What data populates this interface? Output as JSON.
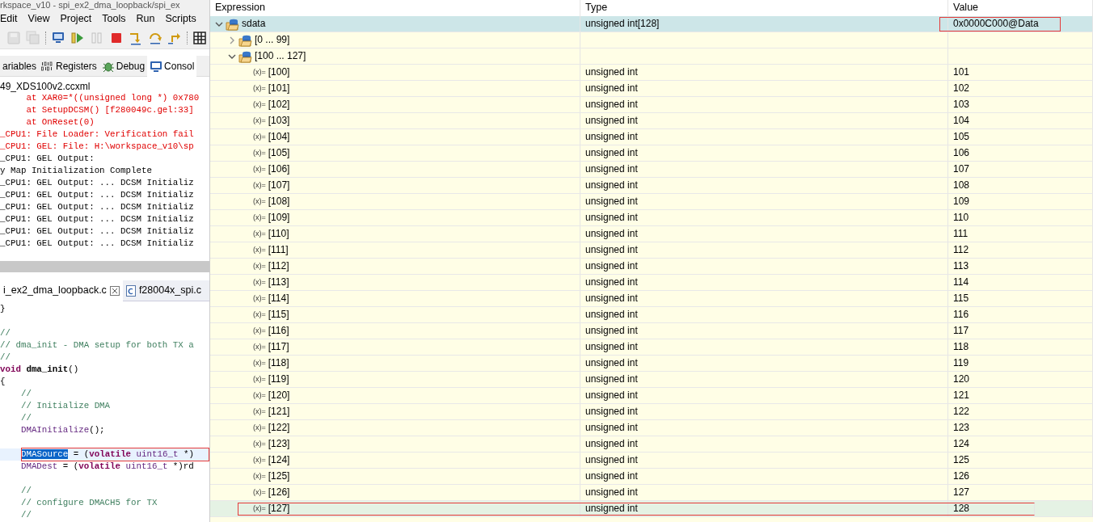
{
  "left_panel": {
    "title_fragment": "rkspace_v10 - spi_ex2_dma_loopback/spi_ex",
    "menu": [
      "Edit",
      "View",
      "Project",
      "Tools",
      "Run",
      "Scripts"
    ],
    "toolbar": [
      {
        "kind": "save",
        "disabled": true
      },
      {
        "kind": "save-all",
        "disabled": true
      },
      {
        "kind": "separator"
      },
      {
        "kind": "debug",
        "disabled": false
      },
      {
        "kind": "resume",
        "disabled": false
      },
      {
        "kind": "suspend",
        "disabled": true
      },
      {
        "kind": "terminate",
        "disabled": false
      },
      {
        "kind": "step-into",
        "disabled": false
      },
      {
        "kind": "step-over",
        "disabled": false
      },
      {
        "kind": "step-return",
        "disabled": false
      },
      {
        "kind": "separator"
      },
      {
        "kind": "grid",
        "disabled": false
      }
    ],
    "view_tabs": [
      {
        "label": "ariables",
        "kind": "none",
        "selected": false
      },
      {
        "label": "Registers",
        "kind": "registers",
        "selected": false
      },
      {
        "label": "Debug",
        "kind": "debug",
        "selected": false
      },
      {
        "label": "Consol",
        "kind": "console",
        "selected": true
      }
    ],
    "console": {
      "title": "49_XDS100v2.ccxml",
      "lines": [
        {
          "text": "     at XAR0=*((unsigned long *) 0x780",
          "kind": "error"
        },
        {
          "text": "     at SetupDCSM() [f280049c.gel:33]",
          "kind": "error"
        },
        {
          "text": "     at OnReset(0)",
          "kind": "error"
        },
        {
          "text": "_CPU1: File Loader: Verification fail",
          "kind": "error"
        },
        {
          "text": "_CPU1: GEL: File: H:\\workspace_v10\\sp",
          "kind": "error"
        },
        {
          "text": "_CPU1: GEL Output:",
          "kind": "normal"
        },
        {
          "text": "y Map Initialization Complete",
          "kind": "normal"
        },
        {
          "text": "_CPU1: GEL Output: ... DCSM Initializ",
          "kind": "normal"
        },
        {
          "text": "_CPU1: GEL Output: ... DCSM Initializ",
          "kind": "normal"
        },
        {
          "text": "_CPU1: GEL Output: ... DCSM Initializ",
          "kind": "normal"
        },
        {
          "text": "_CPU1: GEL Output: ... DCSM Initializ",
          "kind": "normal"
        },
        {
          "text": "_CPU1: GEL Output: ... DCSM Initializ",
          "kind": "normal"
        },
        {
          "text": "_CPU1: GEL Output: ... DCSM Initializ",
          "kind": "normal"
        }
      ]
    },
    "editor": {
      "tabs": [
        {
          "label": "i_ex2_dma_loopback.c",
          "kind": "active",
          "selected": true
        },
        {
          "label": "f28004x_spi.c",
          "kind": "c-file",
          "selected": false
        }
      ],
      "lines": [
        {
          "current": false,
          "marked": false,
          "segments": [
            {
              "text": "}",
              "kind": "plain"
            }
          ]
        },
        {
          "current": false,
          "marked": false
        },
        {
          "current": false,
          "marked": false,
          "segments": [
            {
              "text": "//",
              "kind": "comment"
            }
          ]
        },
        {
          "current": false,
          "marked": false,
          "segments": [
            {
              "text": "// dma_init - DMA setup for both TX a",
              "kind": "comment"
            }
          ]
        },
        {
          "current": false,
          "marked": false,
          "segments": [
            {
              "text": "//",
              "kind": "comment"
            }
          ]
        },
        {
          "current": false,
          "marked": false,
          "segments": [
            {
              "text": "void",
              "kind": "keyword"
            },
            {
              "text": " dma_init",
              "kind": "function"
            },
            {
              "text": "()",
              "kind": "plain"
            }
          ]
        },
        {
          "current": false,
          "marked": false,
          "segments": [
            {
              "text": "{",
              "kind": "plain"
            }
          ]
        },
        {
          "current": false,
          "marked": false,
          "segments": [
            {
              "text": "    //",
              "kind": "comment"
            }
          ]
        },
        {
          "current": false,
          "marked": false,
          "segments": [
            {
              "text": "    // Initialize DMA",
              "kind": "comment"
            }
          ]
        },
        {
          "current": false,
          "marked": false,
          "segments": [
            {
              "text": "    //",
              "kind": "comment"
            }
          ]
        },
        {
          "current": false,
          "marked": false,
          "segments": [
            {
              "text": "    DMAInitialize",
              "kind": "macro"
            },
            {
              "text": "();",
              "kind": "plain"
            }
          ]
        },
        {
          "current": false,
          "marked": false
        },
        {
          "current": true,
          "marked": true,
          "segments": [
            {
              "text": "DMASource",
              "kind": "selection"
            },
            {
              "text": " = (",
              "kind": "plain"
            },
            {
              "text": "volatile",
              "kind": "keyword"
            },
            {
              "text": " uint16_t",
              "kind": "macro"
            },
            {
              "text": " *)",
              "kind": "plain"
            }
          ]
        },
        {
          "current": false,
          "marked": false,
          "segments": [
            {
              "text": "    DMADest",
              "kind": "macro"
            },
            {
              "text": " = (",
              "kind": "plain"
            },
            {
              "text": "volatile",
              "kind": "keyword"
            },
            {
              "text": " uint16_t",
              "kind": "macro"
            },
            {
              "text": " *)rd",
              "kind": "plain"
            }
          ]
        },
        {
          "current": false,
          "marked": false
        },
        {
          "current": false,
          "marked": false,
          "segments": [
            {
              "text": "    //",
              "kind": "comment"
            }
          ]
        },
        {
          "current": false,
          "marked": false,
          "segments": [
            {
              "text": "    // configure DMACH5 for TX",
              "kind": "comment"
            }
          ]
        },
        {
          "current": false,
          "marked": false,
          "segments": [
            {
              "text": "    //",
              "kind": "comment"
            }
          ]
        }
      ]
    }
  },
  "expressions": {
    "columns": [
      "Expression",
      "Type",
      "Value"
    ],
    "rows": [
      {
        "name": "sdata",
        "kind": "group",
        "type": "unsigned int[128]",
        "value": "0x0000C000@Data",
        "expanded": true,
        "selected": true,
        "hovered": false,
        "marked": true,
        "children": [
          {
            "name": "[0 ... 99]",
            "kind": "group",
            "expanded": false,
            "selected": false,
            "hovered": false,
            "marked": false
          },
          {
            "name": "[100 ... 127]",
            "kind": "group",
            "expanded": true,
            "selected": false,
            "hovered": false,
            "marked": false,
            "children": [
              {
                "icon": "(x)=",
                "name": "[100]",
                "kind": "variable",
                "type": "unsigned int",
                "value": "101",
                "selected": false,
                "hovered": false,
                "marked": false
              },
              {
                "icon": "(x)=",
                "name": "[101]",
                "kind": "variable",
                "type": "unsigned int",
                "value": "102",
                "selected": false,
                "hovered": false,
                "marked": false
              },
              {
                "icon": "(x)=",
                "name": "[102]",
                "kind": "variable",
                "type": "unsigned int",
                "value": "103",
                "selected": false,
                "hovered": false,
                "marked": false
              },
              {
                "icon": "(x)=",
                "name": "[103]",
                "kind": "variable",
                "type": "unsigned int",
                "value": "104",
                "selected": false,
                "hovered": false,
                "marked": false
              },
              {
                "icon": "(x)=",
                "name": "[104]",
                "kind": "variable",
                "type": "unsigned int",
                "value": "105",
                "selected": false,
                "hovered": false,
                "marked": false
              },
              {
                "icon": "(x)=",
                "name": "[105]",
                "kind": "variable",
                "type": "unsigned int",
                "value": "106",
                "selected": false,
                "hovered": false,
                "marked": false
              },
              {
                "icon": "(x)=",
                "name": "[106]",
                "kind": "variable",
                "type": "unsigned int",
                "value": "107",
                "selected": false,
                "hovered": false,
                "marked": false
              },
              {
                "icon": "(x)=",
                "name": "[107]",
                "kind": "variable",
                "type": "unsigned int",
                "value": "108",
                "selected": false,
                "hovered": false,
                "marked": false
              },
              {
                "icon": "(x)=",
                "name": "[108]",
                "kind": "variable",
                "type": "unsigned int",
                "value": "109",
                "selected": false,
                "hovered": false,
                "marked": false
              },
              {
                "icon": "(x)=",
                "name": "[109]",
                "kind": "variable",
                "type": "unsigned int",
                "value": "110",
                "selected": false,
                "hovered": false,
                "marked": false
              },
              {
                "icon": "(x)=",
                "name": "[110]",
                "kind": "variable",
                "type": "unsigned int",
                "value": "111",
                "selected": false,
                "hovered": false,
                "marked": false
              },
              {
                "icon": "(x)=",
                "name": "[111]",
                "kind": "variable",
                "type": "unsigned int",
                "value": "112",
                "selected": false,
                "hovered": false,
                "marked": false
              },
              {
                "icon": "(x)=",
                "name": "[112]",
                "kind": "variable",
                "type": "unsigned int",
                "value": "113",
                "selected": false,
                "hovered": false,
                "marked": false
              },
              {
                "icon": "(x)=",
                "name": "[113]",
                "kind": "variable",
                "type": "unsigned int",
                "value": "114",
                "selected": false,
                "hovered": false,
                "marked": false
              },
              {
                "icon": "(x)=",
                "name": "[114]",
                "kind": "variable",
                "type": "unsigned int",
                "value": "115",
                "selected": false,
                "hovered": false,
                "marked": false
              },
              {
                "icon": "(x)=",
                "name": "[115]",
                "kind": "variable",
                "type": "unsigned int",
                "value": "116",
                "selected": false,
                "hovered": false,
                "marked": false
              },
              {
                "icon": "(x)=",
                "name": "[116]",
                "kind": "variable",
                "type": "unsigned int",
                "value": "117",
                "selected": false,
                "hovered": false,
                "marked": false
              },
              {
                "icon": "(x)=",
                "name": "[117]",
                "kind": "variable",
                "type": "unsigned int",
                "value": "118",
                "selected": false,
                "hovered": false,
                "marked": false
              },
              {
                "icon": "(x)=",
                "name": "[118]",
                "kind": "variable",
                "type": "unsigned int",
                "value": "119",
                "selected": false,
                "hovered": false,
                "marked": false
              },
              {
                "icon": "(x)=",
                "name": "[119]",
                "kind": "variable",
                "type": "unsigned int",
                "value": "120",
                "selected": false,
                "hovered": false,
                "marked": false
              },
              {
                "icon": "(x)=",
                "name": "[120]",
                "kind": "variable",
                "type": "unsigned int",
                "value": "121",
                "selected": false,
                "hovered": false,
                "marked": false
              },
              {
                "icon": "(x)=",
                "name": "[121]",
                "kind": "variable",
                "type": "unsigned int",
                "value": "122",
                "selected": false,
                "hovered": false,
                "marked": false
              },
              {
                "icon": "(x)=",
                "name": "[122]",
                "kind": "variable",
                "type": "unsigned int",
                "value": "123",
                "selected": false,
                "hovered": false,
                "marked": false
              },
              {
                "icon": "(x)=",
                "name": "[123]",
                "kind": "variable",
                "type": "unsigned int",
                "value": "124",
                "selected": false,
                "hovered": false,
                "marked": false
              },
              {
                "icon": "(x)=",
                "name": "[124]",
                "kind": "variable",
                "type": "unsigned int",
                "value": "125",
                "selected": false,
                "hovered": false,
                "marked": false
              },
              {
                "icon": "(x)=",
                "name": "[125]",
                "kind": "variable",
                "type": "unsigned int",
                "value": "126",
                "selected": false,
                "hovered": false,
                "marked": false
              },
              {
                "icon": "(x)=",
                "name": "[126]",
                "kind": "variable",
                "type": "unsigned int",
                "value": "127",
                "selected": false,
                "hovered": false,
                "marked": false
              },
              {
                "icon": "(x)=",
                "name": "[127]",
                "kind": "variable",
                "type": "unsigned int",
                "value": "128",
                "selected": false,
                "hovered": true,
                "marked": true
              }
            ]
          }
        ]
      }
    ]
  }
}
